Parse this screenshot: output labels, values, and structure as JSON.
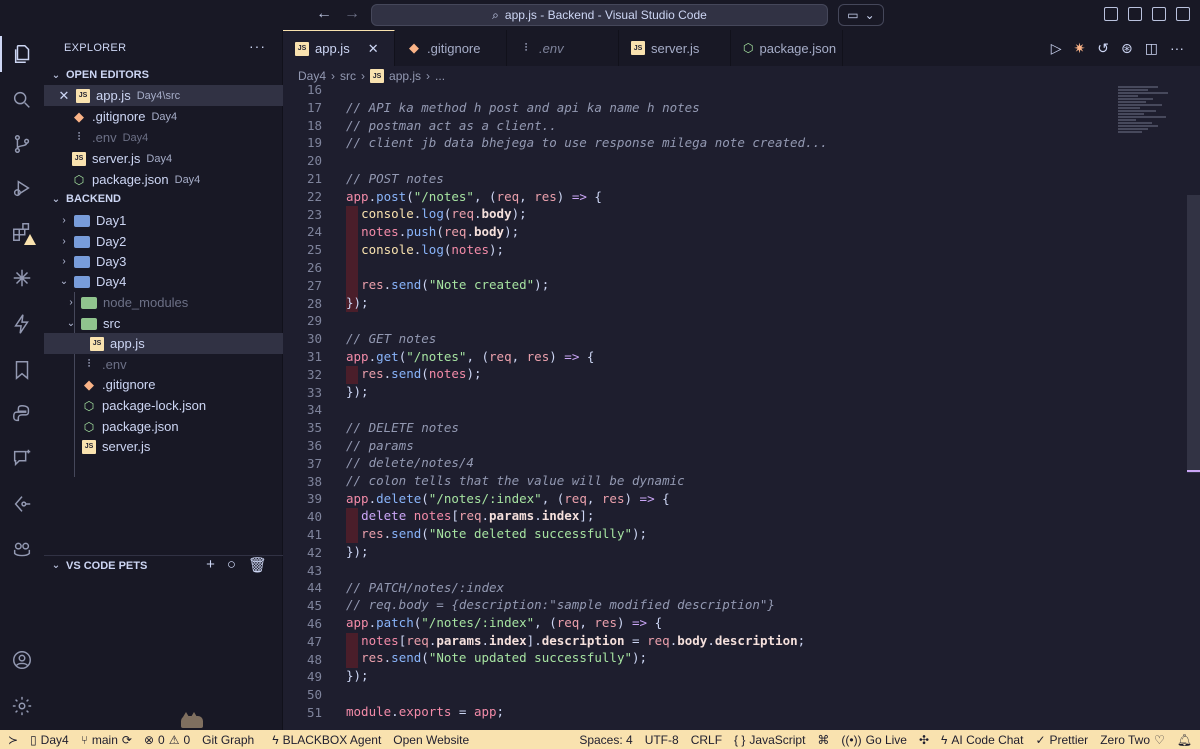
{
  "window": {
    "title": "app.js - Backend - Visual Studio Code"
  },
  "explorer": {
    "title": "EXPLORER",
    "open_editors": {
      "label": "OPEN EDITORS",
      "items": [
        {
          "name": "app.js",
          "desc": "Day4\\src"
        },
        {
          "name": ".gitignore",
          "desc": "Day4"
        },
        {
          "name": ".env",
          "desc": "Day4"
        },
        {
          "name": "server.js",
          "desc": "Day4"
        },
        {
          "name": "package.json",
          "desc": "Day4"
        }
      ]
    },
    "workspace": {
      "label": "BACKEND",
      "items": [
        {
          "name": "Day1"
        },
        {
          "name": "Day2"
        },
        {
          "name": "Day3"
        },
        {
          "name": "Day4"
        },
        {
          "name": "node_modules"
        },
        {
          "name": "src"
        },
        {
          "name": "app.js"
        },
        {
          "name": ".env"
        },
        {
          "name": ".gitignore"
        },
        {
          "name": "package-lock.json"
        },
        {
          "name": "package.json"
        },
        {
          "name": "server.js"
        }
      ]
    },
    "pets": {
      "label": "VS CODE PETS"
    }
  },
  "tabs": [
    {
      "label": "app.js"
    },
    {
      "label": ".gitignore"
    },
    {
      "label": ".env"
    },
    {
      "label": "server.js"
    },
    {
      "label": "package.json"
    }
  ],
  "breadcrumb": [
    "Day4",
    "src",
    "app.js",
    "..."
  ],
  "editor": {
    "line_numbers": [
      "16",
      "17",
      "18",
      "19",
      "20",
      "21",
      "22",
      "23",
      "24",
      "25",
      "26",
      "27",
      "28",
      "29",
      "30",
      "31",
      "32",
      "33",
      "34",
      "35",
      "36",
      "37",
      "38",
      "39",
      "40",
      "41",
      "42",
      "43",
      "44",
      "45",
      "46",
      "47",
      "48",
      "49",
      "50",
      "51"
    ]
  },
  "statusbar": {
    "branch_folder": "Day4",
    "branch": "main",
    "errors": "0",
    "warnings": "0",
    "git_graph": "Git Graph",
    "blackbox": "BLACKBOX Agent",
    "open_website": "Open Website",
    "spaces": "Spaces: 4",
    "encoding": "UTF-8",
    "eol": "CRLF",
    "language": "JavaScript",
    "go_live": "Go Live",
    "ai_chat": "AI Code Chat",
    "prettier": "Prettier",
    "zero_two": "Zero Two"
  },
  "colors": {
    "statusbar_bg": "#f9e2af",
    "editor_bg": "#1e1e2e",
    "sidebar_bg": "#181825"
  }
}
